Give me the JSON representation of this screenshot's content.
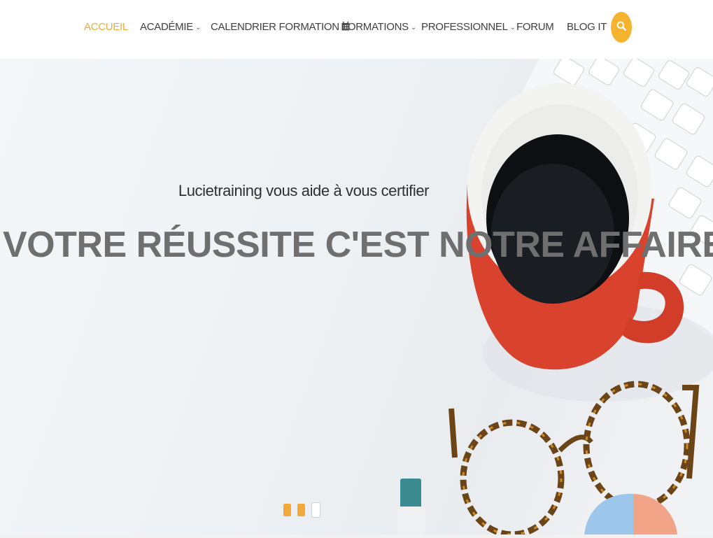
{
  "nav": {
    "items": [
      {
        "label": "ACCUEIL",
        "active": true,
        "dropdown": false
      },
      {
        "label": "ACADÉMIE",
        "active": false,
        "dropdown": true
      },
      {
        "label": "CALENDRIER FORMATION",
        "active": false,
        "dropdown": false,
        "icon": "calendar-icon"
      },
      {
        "label": "FORMATIONS",
        "active": false,
        "dropdown": true
      },
      {
        "label": "PROFESSIONNEL",
        "active": false,
        "dropdown": true
      },
      {
        "label": "FORUM",
        "active": false,
        "dropdown": false
      },
      {
        "label": "BLOG IT",
        "active": false,
        "dropdown": false
      }
    ],
    "search_icon": "search-icon"
  },
  "hero": {
    "subtitle": "Lucietraining vous aide à vous certifier",
    "title": "VOTRE RÉUSSITE C'EST NOTRE AFFAIRE",
    "slides": 3,
    "active_slide": 3
  },
  "colors": {
    "accent": "#f0ab34",
    "search_button": "#f6b330",
    "nav_text": "#3f3f3f",
    "title_text": "#6f6f6f"
  }
}
